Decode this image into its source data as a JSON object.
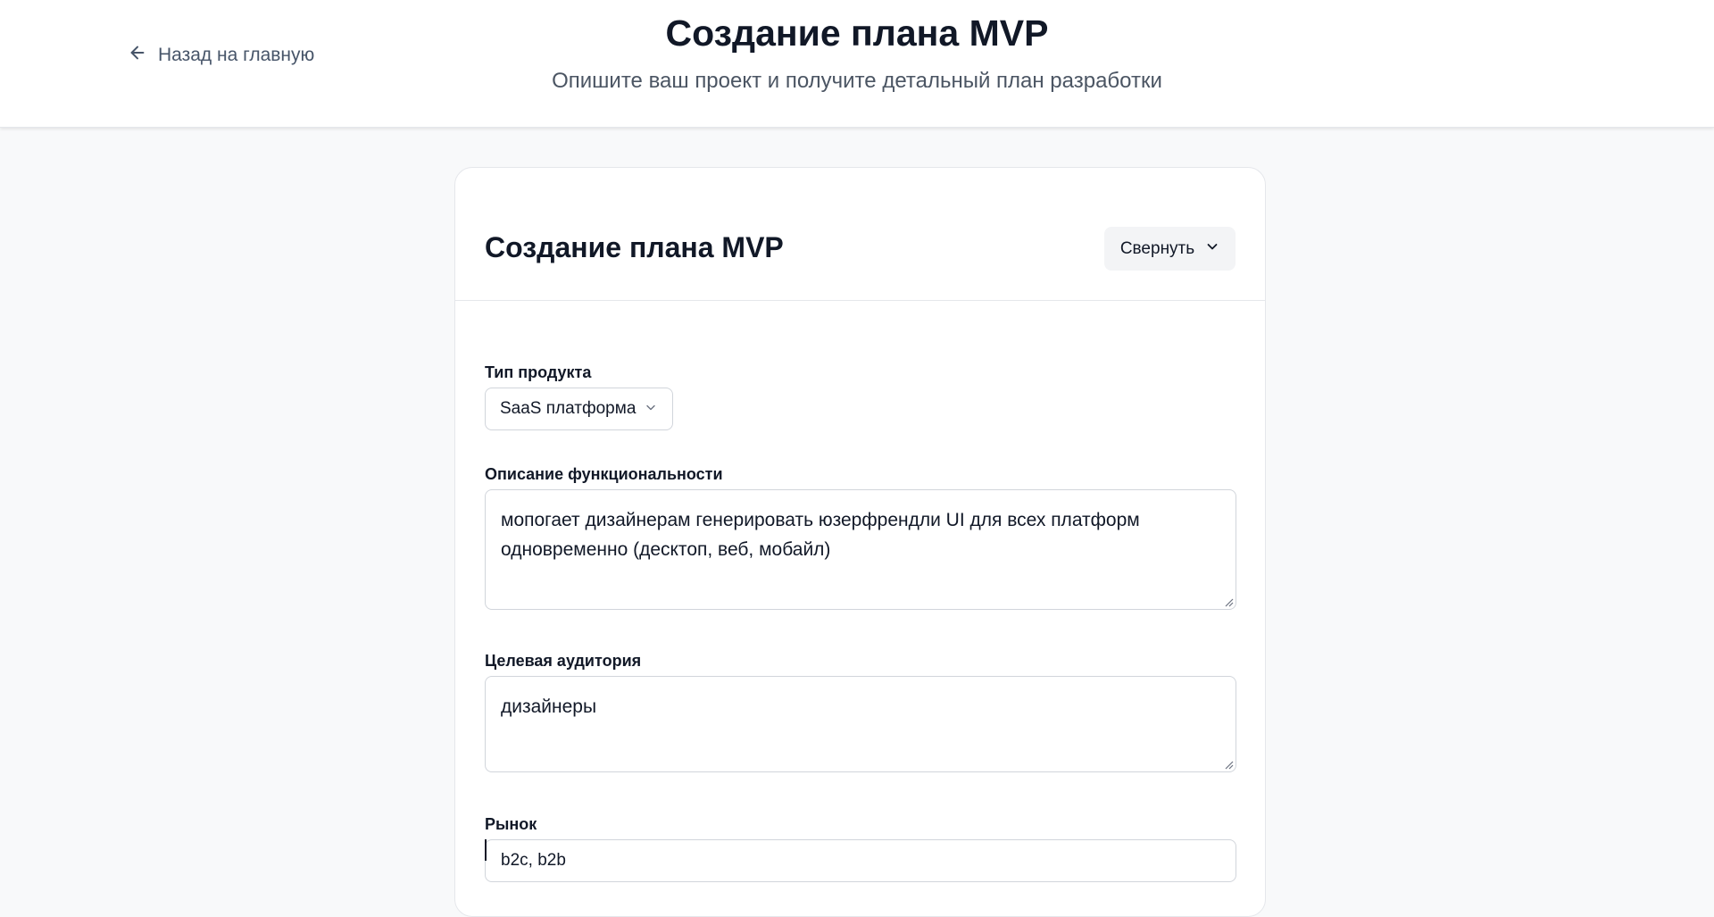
{
  "header": {
    "back_label": "Назад на главную",
    "title": "Создание плана MVP",
    "subtitle": "Опишите ваш проект и получите детальный план разработки"
  },
  "card": {
    "title": "Создание плана MVP",
    "collapse_label": "Свернуть",
    "fields": {
      "product_type": {
        "label": "Тип продукта",
        "selected": "SaaS платформа"
      },
      "functionality": {
        "label": "Описание функциональности",
        "value": "мопогает дизайнерам генерировать юзерфрендли UI для всех платформ одновременно (десктоп, веб, мобайл)"
      },
      "audience": {
        "label": "Целевая аудитория",
        "value": "дизайнеры"
      },
      "market": {
        "label": "Рынок",
        "value": "b2c, b2b"
      }
    }
  },
  "icons": {
    "back": "arrow-left-icon",
    "collapse": "chevron-down-icon",
    "select": "chevron-down-icon"
  },
  "colors": {
    "page_background": "#f8f9fa",
    "card_background": "#ffffff",
    "border": "#e5e7eb",
    "button_background": "#f3f4f6",
    "text_primary": "#111827",
    "text_muted": "#4b5563"
  }
}
